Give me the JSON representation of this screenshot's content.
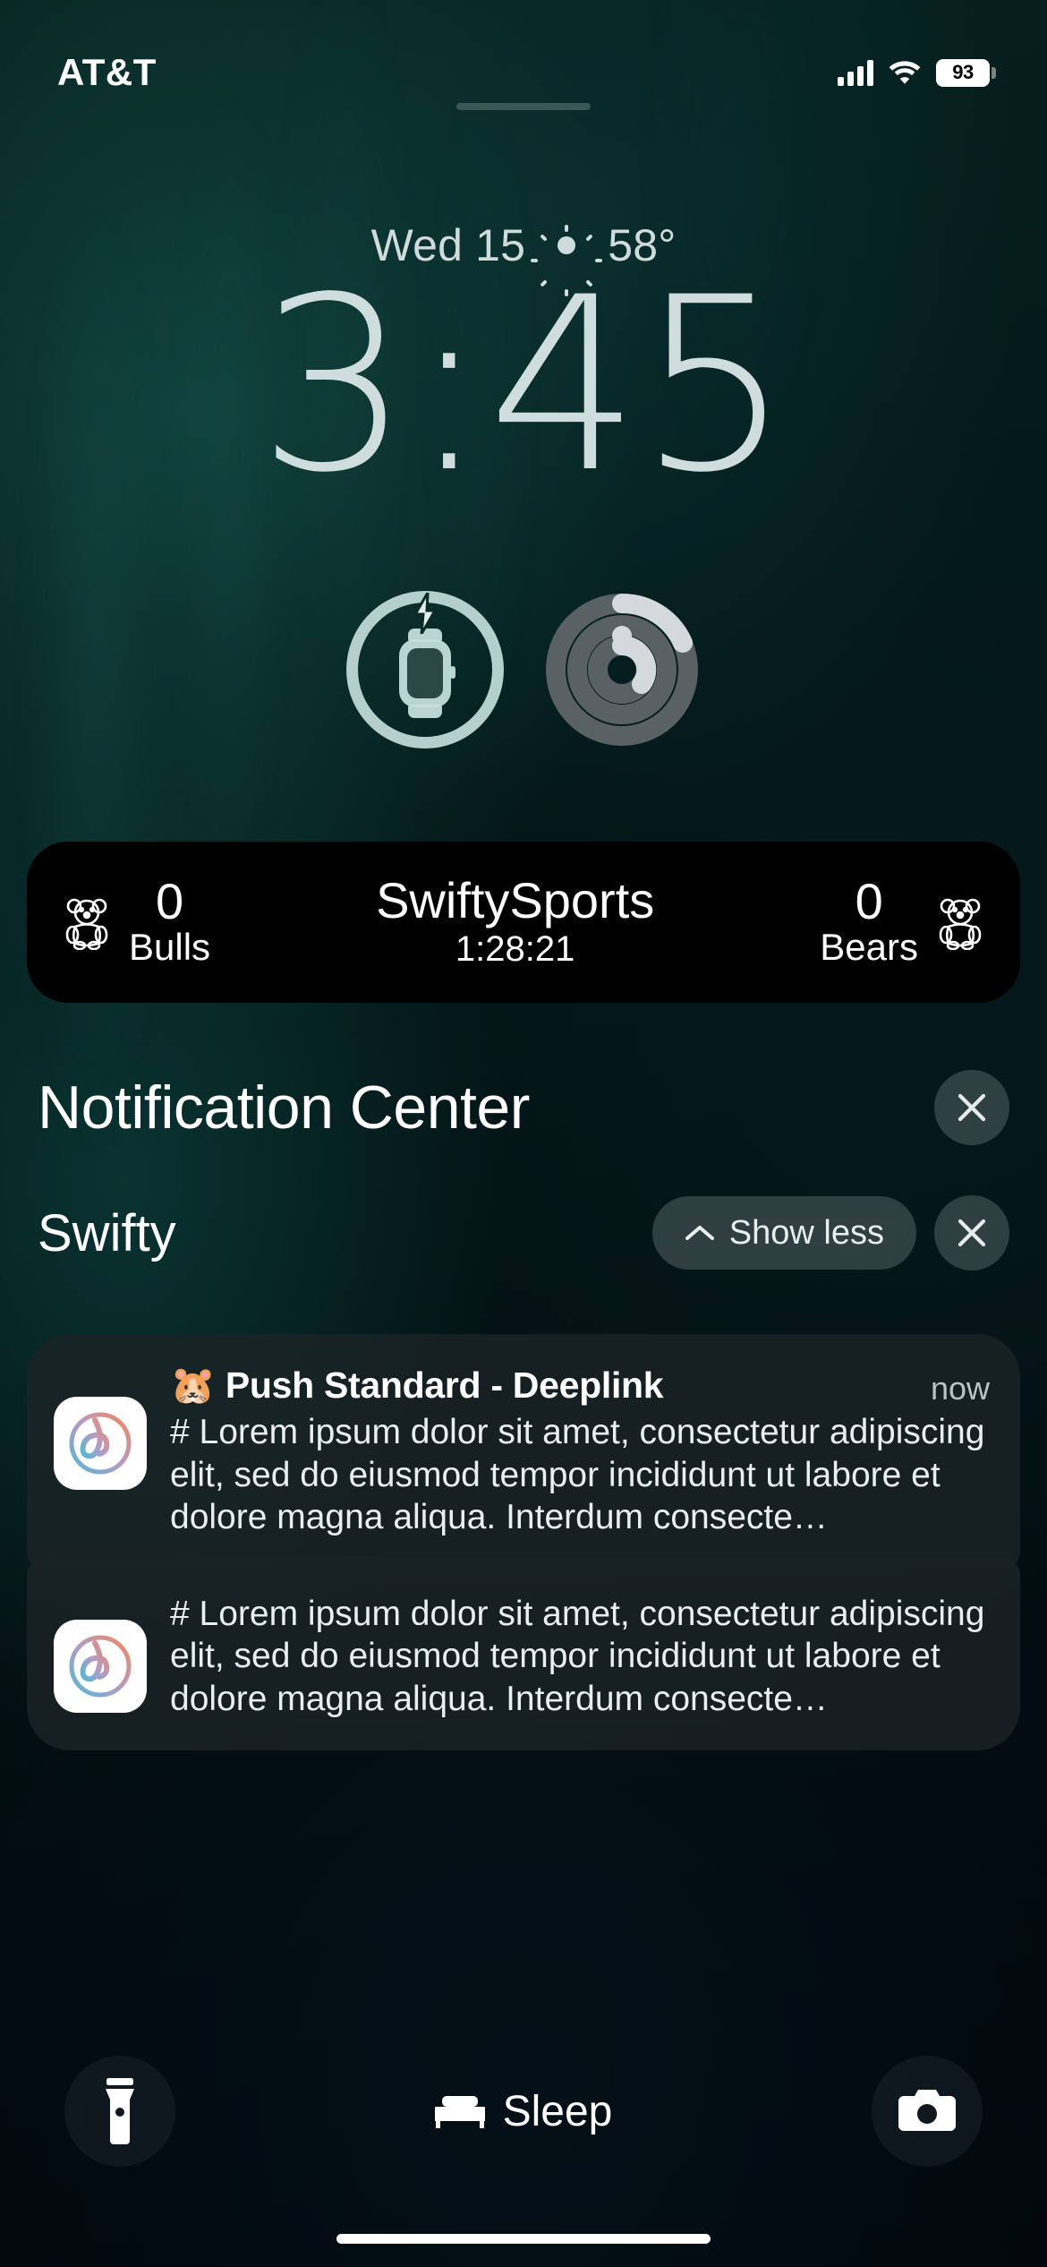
{
  "status_bar": {
    "carrier": "AT&T",
    "battery_percent": "93",
    "signal_icon": "cellular-bars-icon",
    "wifi_icon": "wifi-icon"
  },
  "lock_screen": {
    "date": "Wed 15",
    "weather_icon": "sun-icon",
    "temperature": "58°",
    "time": "3:45"
  },
  "widgets": [
    {
      "name": "watch-battery-widget",
      "icon": "watch-charging-icon"
    },
    {
      "name": "activity-rings-widget",
      "icon": "activity-rings-icon"
    }
  ],
  "live_activity": {
    "app_title": "SwiftySports",
    "timer": "1:28:21",
    "home": {
      "icon": "teddy-bear-icon",
      "score": "0",
      "team": "Bulls"
    },
    "away": {
      "icon": "teddy-bear-icon",
      "score": "0",
      "team": "Bears"
    }
  },
  "notification_center": {
    "title": "Notification Center",
    "clear_icon": "close-icon",
    "group": {
      "title": "Swifty",
      "show_less_label": "Show less",
      "chevron_icon": "chevron-up-icon",
      "clear_icon": "close-icon"
    },
    "notifications": [
      {
        "app_icon": "swifty-app-icon",
        "title": "🐹 Push Standard - Deeplink",
        "timestamp": "now",
        "body": "# Lorem ipsum dolor sit amet, consectetur adipiscing elit, sed do eiusmod tempor incididunt ut labore et dolore magna aliqua. Interdum consecte…"
      },
      {
        "app_icon": "swifty-app-icon",
        "title": "",
        "timestamp": "",
        "body": "# Lorem ipsum dolor sit amet, consectetur adipiscing elit, sed do eiusmod tempor incididunt ut labore et dolore magna aliqua. Interdum consecte…"
      }
    ]
  },
  "bottom_controls": {
    "flashlight_icon": "flashlight-icon",
    "camera_icon": "camera-icon",
    "focus_label": "Sleep",
    "focus_icon": "bed-icon"
  },
  "colors": {
    "clock": "#cfdedc",
    "accent_teal": "#0d3a38",
    "notification_bg": "#1c2426"
  }
}
